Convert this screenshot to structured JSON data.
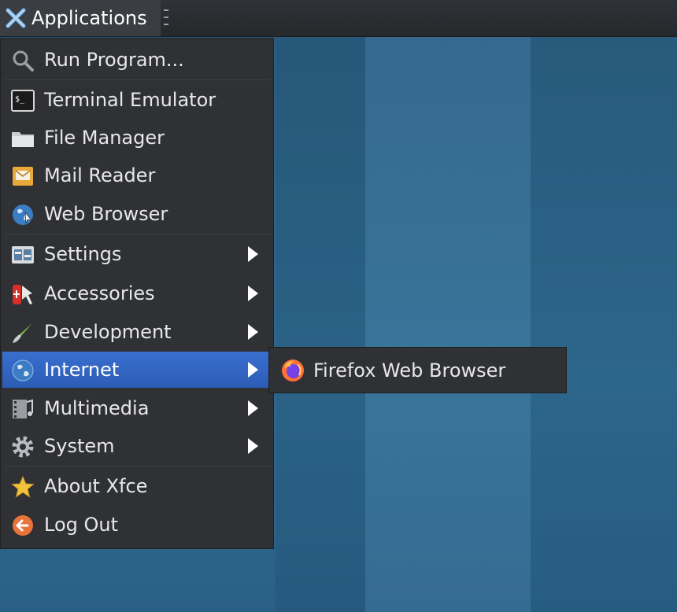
{
  "panel": {
    "applications_label": "Applications"
  },
  "menu": {
    "items": [
      {
        "label": "Run Program...",
        "icon": "search-icon"
      },
      {
        "label": "Terminal Emulator",
        "icon": "terminal-icon"
      },
      {
        "label": "File Manager",
        "icon": "folder-icon"
      },
      {
        "label": "Mail Reader",
        "icon": "mail-icon"
      },
      {
        "label": "Web Browser",
        "icon": "globe-icon"
      },
      {
        "label": "Settings",
        "icon": "settings-icon",
        "submenu": true
      },
      {
        "label": "Accessories",
        "icon": "accessories-icon",
        "submenu": true
      },
      {
        "label": "Development",
        "icon": "brush-icon",
        "submenu": true
      },
      {
        "label": "Internet",
        "icon": "globe-icon",
        "submenu": true,
        "active": true
      },
      {
        "label": "Multimedia",
        "icon": "multimedia-icon",
        "submenu": true
      },
      {
        "label": "System",
        "icon": "gear-icon",
        "submenu": true
      },
      {
        "label": "About Xfce",
        "icon": "star-icon"
      },
      {
        "label": "Log Out",
        "icon": "logout-icon"
      }
    ]
  },
  "submenu": {
    "items": [
      {
        "label": "Firefox Web Browser",
        "icon": "firefox-icon"
      }
    ]
  },
  "colors": {
    "active_item": "#3a6fcf",
    "menu_background": "#2f3134",
    "desktop": "#2f6b90"
  }
}
